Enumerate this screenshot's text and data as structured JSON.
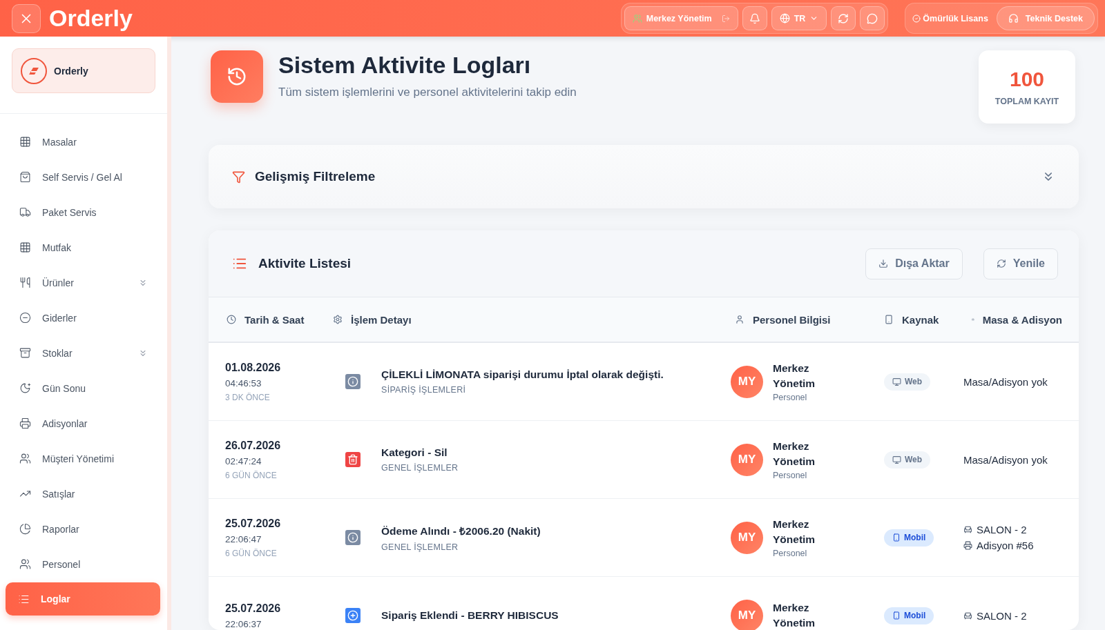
{
  "topbar": {
    "logo": "Orderly",
    "branch": "Merkez Yönetim",
    "language": "TR",
    "license": "Ömürlük Lisans",
    "support": "Teknik Destek"
  },
  "sidebar": {
    "brand": "Orderly",
    "items": [
      {
        "label": "Masalar",
        "selected": false
      },
      {
        "label": "Self Servis / Gel Al",
        "selected": false
      },
      {
        "label": "Paket Servis",
        "selected": false
      },
      {
        "label": "Mutfak",
        "selected": false
      },
      {
        "label": "Ürünler",
        "selected": false,
        "expandable": true
      },
      {
        "label": "Giderler",
        "selected": false
      },
      {
        "label": "Stoklar",
        "selected": false,
        "expandable": true
      },
      {
        "label": "Gün Sonu",
        "selected": false
      },
      {
        "label": "Adisyonlar",
        "selected": false
      },
      {
        "label": "Müşteri Yönetimi",
        "selected": false
      },
      {
        "label": "Satışlar",
        "selected": false
      },
      {
        "label": "Raporlar",
        "selected": false
      },
      {
        "label": "Personel",
        "selected": false
      },
      {
        "label": "Loglar",
        "selected": true
      }
    ]
  },
  "page": {
    "title": "Sistem Aktivite Logları",
    "subtitle": "Tüm sistem işlemlerini ve personel aktivitelerini takip edin",
    "stat_value": "100",
    "stat_label": "TOPLAM KAYIT"
  },
  "filter": {
    "title": "Gelişmiş Filtreleme",
    "expanded": false
  },
  "activity": {
    "title": "Aktivite Listesi",
    "buttons": [
      "Dışa Aktar",
      "Yenile"
    ],
    "columns": [
      "Tarih & Saat",
      "İşlem Detayı",
      "Personel Bilgisi",
      "Kaynak",
      "Masa & Adisyon"
    ],
    "rows": [
      {
        "date": "01.08.2026",
        "time": "04:46:53",
        "ago": "3 DK ÖNCE",
        "kind": "info",
        "title": "ÇİLEKLİ LİMONATA siparişi durumu İptal olarak değişti.",
        "category": "SİPARİŞ İŞLEMLERİ",
        "initials": "MY",
        "name": "Merkez Yönetim",
        "role": "Personel",
        "source": {
          "kind": "web",
          "label": "Web"
        },
        "table": [
          {
            "kind": "none",
            "text": "Masa/Adisyon yok"
          }
        ]
      },
      {
        "date": "26.07.2026",
        "time": "02:47:24",
        "ago": "6 GÜN ÖNCE",
        "kind": "delete",
        "title": "Kategori - Sil",
        "category": "GENEL İŞLEMLER",
        "initials": "MY",
        "name": "Merkez Yönetim",
        "role": "Personel",
        "source": {
          "kind": "web",
          "label": "Web"
        },
        "table": [
          {
            "kind": "none",
            "text": "Masa/Adisyon yok"
          }
        ]
      },
      {
        "date": "25.07.2026",
        "time": "22:06:47",
        "ago": "6 GÜN ÖNCE",
        "kind": "info",
        "title": "Ödeme Alındı - ₺2006.20 (Nakit)",
        "category": "GENEL İŞLEMLER",
        "initials": "MY",
        "name": "Merkez Yönetim",
        "role": "Personel",
        "source": {
          "kind": "mobile",
          "label": "Mobil"
        },
        "table": [
          {
            "kind": "table",
            "text": "SALON - 2"
          },
          {
            "kind": "bill",
            "text": "Adisyon #56"
          }
        ]
      },
      {
        "date": "25.07.2026",
        "time": "22:06:37",
        "kind": "add",
        "title": "Sipariş Eklendi - BERRY HIBISCUS",
        "initials": "MY",
        "name": "Merkez Yönetim",
        "source": {
          "kind": "mobile",
          "label": "Mobil"
        },
        "table": [
          {
            "kind": "table",
            "text": "SALON - 2"
          }
        ]
      }
    ]
  }
}
